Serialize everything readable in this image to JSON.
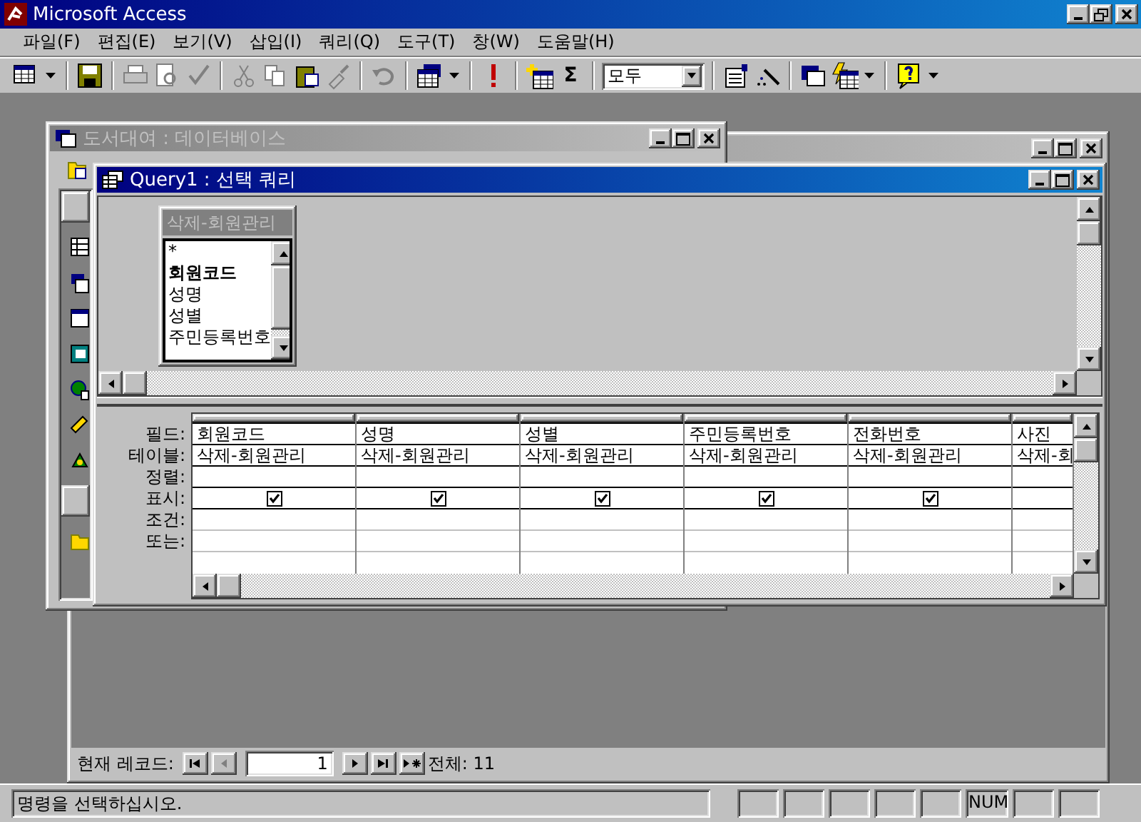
{
  "app": {
    "title": "Microsoft Access"
  },
  "menu": [
    {
      "label": "파일(F)"
    },
    {
      "label": "편집(E)"
    },
    {
      "label": "보기(V)"
    },
    {
      "label": "삽입(I)"
    },
    {
      "label": "쿼리(Q)"
    },
    {
      "label": "도구(T)"
    },
    {
      "label": "창(W)"
    },
    {
      "label": "도움말(H)"
    }
  ],
  "toolbar": {
    "totals": "Σ",
    "combo_value": "모두"
  },
  "database_window": {
    "title": "도서대여 : 데이터베이스"
  },
  "form_window": {
    "record_label": "현재 레코드:",
    "record_value": "1",
    "total": "전체: 11"
  },
  "query_window": {
    "title": "Query1 : 선택 쿼리",
    "field_list": {
      "title": "삭제-회원관리",
      "fields": [
        {
          "name": "*",
          "key": false
        },
        {
          "name": "회원코드",
          "key": true
        },
        {
          "name": "성명",
          "key": false
        },
        {
          "name": "성별",
          "key": false
        },
        {
          "name": "주민등록번호",
          "key": false
        }
      ]
    },
    "grid": {
      "row_labels": [
        "필드:",
        "테이블:",
        "정렬:",
        "표시:",
        "조건:",
        "또는:"
      ],
      "columns": [
        {
          "field": "회원코드",
          "table": "삭제-회원관리",
          "show": true
        },
        {
          "field": "성명",
          "table": "삭제-회원관리",
          "show": true
        },
        {
          "field": "성별",
          "table": "삭제-회원관리",
          "show": true
        },
        {
          "field": "주민등록번호",
          "table": "삭제-회원관리",
          "show": true
        },
        {
          "field": "전화번호",
          "table": "삭제-회원관리",
          "show": true
        },
        {
          "field": "사진",
          "table": "삭제-회"
        }
      ]
    }
  },
  "status_bar": {
    "message": "명령을 선택하십시오.",
    "indicators": [
      "NUM"
    ]
  }
}
